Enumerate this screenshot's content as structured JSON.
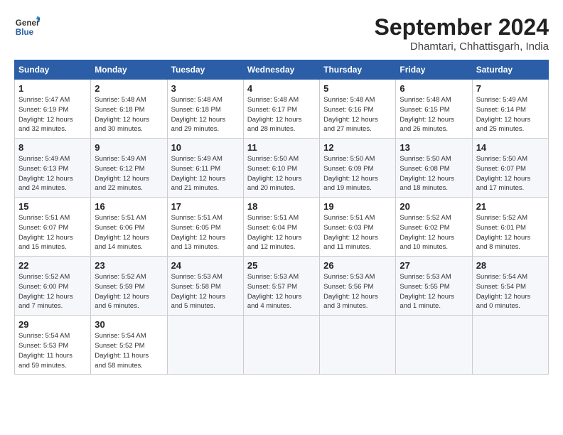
{
  "header": {
    "logo_line1": "General",
    "logo_line2": "Blue",
    "month": "September 2024",
    "location": "Dhamtari, Chhattisgarh, India"
  },
  "weekdays": [
    "Sunday",
    "Monday",
    "Tuesday",
    "Wednesday",
    "Thursday",
    "Friday",
    "Saturday"
  ],
  "weeks": [
    [
      {
        "day": "1",
        "sunrise": "5:47 AM",
        "sunset": "6:19 PM",
        "daylight": "12 hours and 32 minutes."
      },
      {
        "day": "2",
        "sunrise": "5:48 AM",
        "sunset": "6:18 PM",
        "daylight": "12 hours and 30 minutes."
      },
      {
        "day": "3",
        "sunrise": "5:48 AM",
        "sunset": "6:18 PM",
        "daylight": "12 hours and 29 minutes."
      },
      {
        "day": "4",
        "sunrise": "5:48 AM",
        "sunset": "6:17 PM",
        "daylight": "12 hours and 28 minutes."
      },
      {
        "day": "5",
        "sunrise": "5:48 AM",
        "sunset": "6:16 PM",
        "daylight": "12 hours and 27 minutes."
      },
      {
        "day": "6",
        "sunrise": "5:48 AM",
        "sunset": "6:15 PM",
        "daylight": "12 hours and 26 minutes."
      },
      {
        "day": "7",
        "sunrise": "5:49 AM",
        "sunset": "6:14 PM",
        "daylight": "12 hours and 25 minutes."
      }
    ],
    [
      {
        "day": "8",
        "sunrise": "5:49 AM",
        "sunset": "6:13 PM",
        "daylight": "12 hours and 24 minutes."
      },
      {
        "day": "9",
        "sunrise": "5:49 AM",
        "sunset": "6:12 PM",
        "daylight": "12 hours and 22 minutes."
      },
      {
        "day": "10",
        "sunrise": "5:49 AM",
        "sunset": "6:11 PM",
        "daylight": "12 hours and 21 minutes."
      },
      {
        "day": "11",
        "sunrise": "5:50 AM",
        "sunset": "6:10 PM",
        "daylight": "12 hours and 20 minutes."
      },
      {
        "day": "12",
        "sunrise": "5:50 AM",
        "sunset": "6:09 PM",
        "daylight": "12 hours and 19 minutes."
      },
      {
        "day": "13",
        "sunrise": "5:50 AM",
        "sunset": "6:08 PM",
        "daylight": "12 hours and 18 minutes."
      },
      {
        "day": "14",
        "sunrise": "5:50 AM",
        "sunset": "6:07 PM",
        "daylight": "12 hours and 17 minutes."
      }
    ],
    [
      {
        "day": "15",
        "sunrise": "5:51 AM",
        "sunset": "6:07 PM",
        "daylight": "12 hours and 15 minutes."
      },
      {
        "day": "16",
        "sunrise": "5:51 AM",
        "sunset": "6:06 PM",
        "daylight": "12 hours and 14 minutes."
      },
      {
        "day": "17",
        "sunrise": "5:51 AM",
        "sunset": "6:05 PM",
        "daylight": "12 hours and 13 minutes."
      },
      {
        "day": "18",
        "sunrise": "5:51 AM",
        "sunset": "6:04 PM",
        "daylight": "12 hours and 12 minutes."
      },
      {
        "day": "19",
        "sunrise": "5:51 AM",
        "sunset": "6:03 PM",
        "daylight": "12 hours and 11 minutes."
      },
      {
        "day": "20",
        "sunrise": "5:52 AM",
        "sunset": "6:02 PM",
        "daylight": "12 hours and 10 minutes."
      },
      {
        "day": "21",
        "sunrise": "5:52 AM",
        "sunset": "6:01 PM",
        "daylight": "12 hours and 8 minutes."
      }
    ],
    [
      {
        "day": "22",
        "sunrise": "5:52 AM",
        "sunset": "6:00 PM",
        "daylight": "12 hours and 7 minutes."
      },
      {
        "day": "23",
        "sunrise": "5:52 AM",
        "sunset": "5:59 PM",
        "daylight": "12 hours and 6 minutes."
      },
      {
        "day": "24",
        "sunrise": "5:53 AM",
        "sunset": "5:58 PM",
        "daylight": "12 hours and 5 minutes."
      },
      {
        "day": "25",
        "sunrise": "5:53 AM",
        "sunset": "5:57 PM",
        "daylight": "12 hours and 4 minutes."
      },
      {
        "day": "26",
        "sunrise": "5:53 AM",
        "sunset": "5:56 PM",
        "daylight": "12 hours and 3 minutes."
      },
      {
        "day": "27",
        "sunrise": "5:53 AM",
        "sunset": "5:55 PM",
        "daylight": "12 hours and 1 minute."
      },
      {
        "day": "28",
        "sunrise": "5:54 AM",
        "sunset": "5:54 PM",
        "daylight": "12 hours and 0 minutes."
      }
    ],
    [
      {
        "day": "29",
        "sunrise": "5:54 AM",
        "sunset": "5:53 PM",
        "daylight": "11 hours and 59 minutes."
      },
      {
        "day": "30",
        "sunrise": "5:54 AM",
        "sunset": "5:52 PM",
        "daylight": "11 hours and 58 minutes."
      },
      null,
      null,
      null,
      null,
      null
    ]
  ]
}
